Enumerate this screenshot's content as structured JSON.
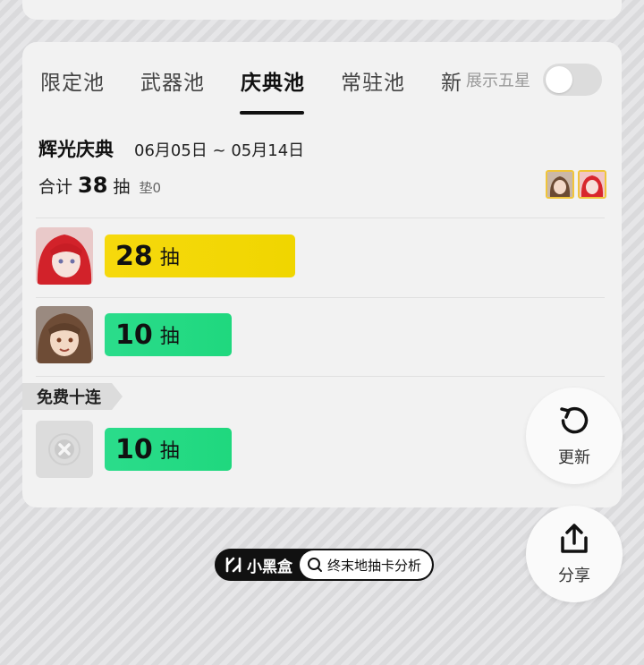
{
  "tabs": [
    {
      "label": "限定池",
      "active": false
    },
    {
      "label": "武器池",
      "active": false
    },
    {
      "label": "庆典池",
      "active": true
    },
    {
      "label": "常驻池",
      "active": false
    },
    {
      "label": "新",
      "active": false
    }
  ],
  "toggle": {
    "label": "展示五星",
    "on": false
  },
  "pool": {
    "name": "辉光庆典",
    "date_range": "06月05日 ~ 05月14日",
    "total_prefix": "合计",
    "total": "38",
    "total_unit": "抽",
    "pity": "垫0"
  },
  "entries": [
    {
      "pulls": "28",
      "unit": "抽",
      "bar_color": "#f2d700",
      "fill": 0.3
    },
    {
      "pulls": "10",
      "unit": "抽",
      "bar_color": "#22d982",
      "fill": 0.19
    }
  ],
  "free_section": {
    "tag": "免费十连",
    "pulls": "10",
    "unit": "抽"
  },
  "buttons": {
    "refresh": "更新",
    "share": "分享"
  },
  "watermark": {
    "brand": "小黑盒",
    "search": "终末地抽卡分析"
  }
}
